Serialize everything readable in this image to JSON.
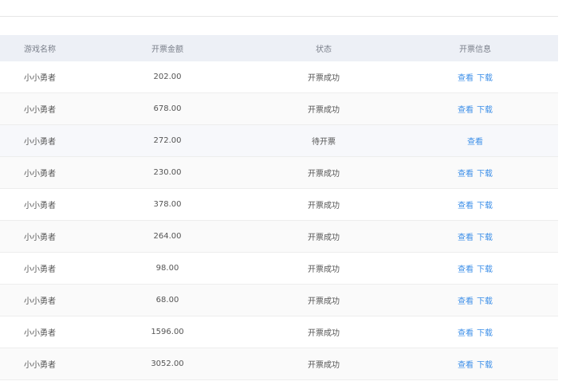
{
  "table": {
    "headers": {
      "game_name": "游戏名称",
      "amount": "开票金额",
      "status": "状态",
      "info": "开票信息"
    },
    "rows": [
      {
        "game_name": "小小勇者",
        "amount": "202.00",
        "status": "开票成功",
        "view": "查看",
        "download": "下载"
      },
      {
        "game_name": "小小勇者",
        "amount": "678.00",
        "status": "开票成功",
        "view": "查看",
        "download": "下载"
      },
      {
        "game_name": "小小勇者",
        "amount": "272.00",
        "status": "待开票",
        "view": "查看",
        "download": null
      },
      {
        "game_name": "小小勇者",
        "amount": "230.00",
        "status": "开票成功",
        "view": "查看",
        "download": "下载"
      },
      {
        "game_name": "小小勇者",
        "amount": "378.00",
        "status": "开票成功",
        "view": "查看",
        "download": "下载"
      },
      {
        "game_name": "小小勇者",
        "amount": "264.00",
        "status": "开票成功",
        "view": "查看",
        "download": "下载"
      },
      {
        "game_name": "小小勇者",
        "amount": "98.00",
        "status": "开票成功",
        "view": "查看",
        "download": "下载"
      },
      {
        "game_name": "小小勇者",
        "amount": "68.00",
        "status": "开票成功",
        "view": "查看",
        "download": "下载"
      },
      {
        "game_name": "小小勇者",
        "amount": "1596.00",
        "status": "开票成功",
        "view": "查看",
        "download": "下载"
      },
      {
        "game_name": "小小勇者",
        "amount": "3052.00",
        "status": "开票成功",
        "view": "查看",
        "download": "下载"
      }
    ]
  },
  "colors": {
    "header_bg": "#edf0f6",
    "link": "#3d8fe8",
    "text": "#555555",
    "border": "#ededed"
  }
}
